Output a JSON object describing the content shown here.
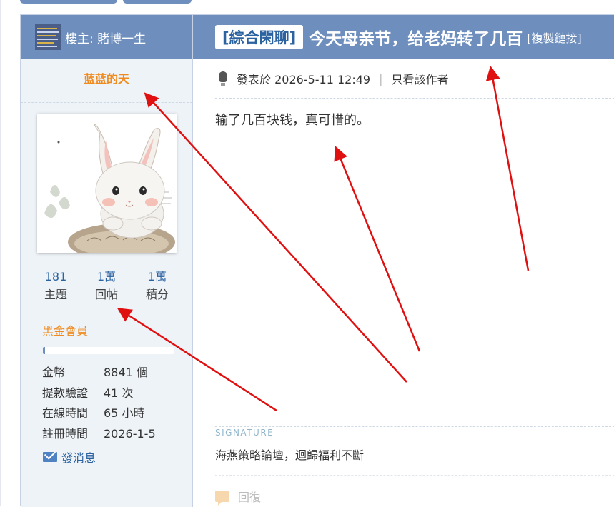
{
  "header": {
    "owner_label": "樓主: 賭博一生",
    "category_tag": "[綜合閑聊]",
    "thread_title": "今天母亲节，给老妈转了几百",
    "copy_link": "[複製鏈接]"
  },
  "author": {
    "name": "蓝蓝的天",
    "stats": [
      {
        "value": "181",
        "label": "主題"
      },
      {
        "value": "1萬",
        "label": "回帖"
      },
      {
        "value": "1萬",
        "label": "積分"
      }
    ],
    "rank": "黑金會員",
    "info": [
      {
        "key": "金幣",
        "value": "8841 個"
      },
      {
        "key": "提款驗證",
        "value": "41 次"
      },
      {
        "key": "在線時間",
        "value": "65 小時"
      },
      {
        "key": "註冊時間",
        "value": "2026-1-5"
      }
    ],
    "message_link": "發消息"
  },
  "post": {
    "posted_label": "發表於 2026-5-11 12:49",
    "separator": "|",
    "only_author": "只看該作者",
    "content": "输了几百块钱，真可惜的。",
    "signature_label": "SIGNATURE",
    "signature_text": "海燕策略論壇，迴歸福利不斷",
    "reply_label": "回復"
  },
  "colors": {
    "header_bg": "#6e8fbe",
    "accent_orange": "#f08a1c",
    "link_blue": "#2b62a0",
    "arrow_red": "#e01010"
  },
  "icons": [
    "bulb-icon",
    "mail-icon",
    "reply-icon"
  ]
}
